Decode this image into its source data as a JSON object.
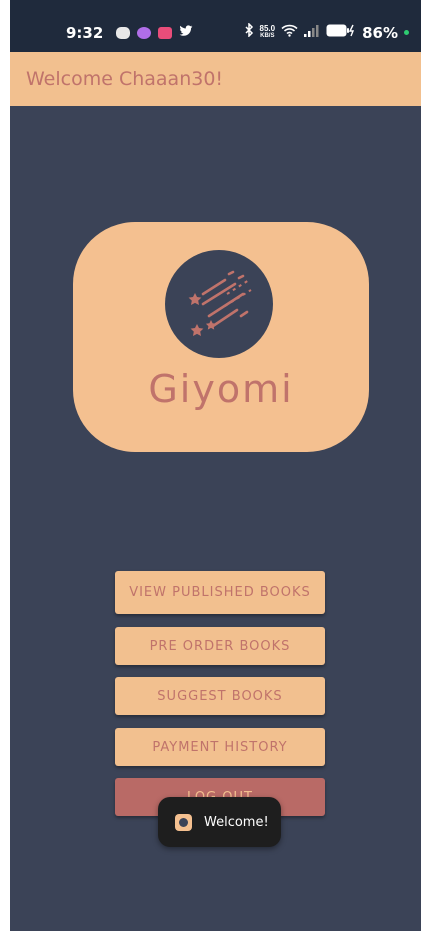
{
  "status_bar": {
    "time": "9:32",
    "network_speed_value": "85.0",
    "network_speed_unit": "KB/S",
    "battery_percent": "86%"
  },
  "app_bar": {
    "title": "Welcome Chaaan30!"
  },
  "logo": {
    "title": "Giyomi"
  },
  "menu": {
    "view_published": "VIEW PUBLISHED BOOKS",
    "pre_order": "PRE ORDER BOOKS",
    "suggest": "SUGGEST BOOKS",
    "payment_history": "PAYMENT HISTORY",
    "log_out": "LOG OUT"
  },
  "toast": {
    "message": "Welcome!"
  },
  "colors": {
    "background": "#3b4357",
    "accent_peach": "#f2c08f",
    "accent_rose": "#c0736b",
    "logout_button": "#b96a66",
    "status_bar": "#1f2a3c"
  }
}
